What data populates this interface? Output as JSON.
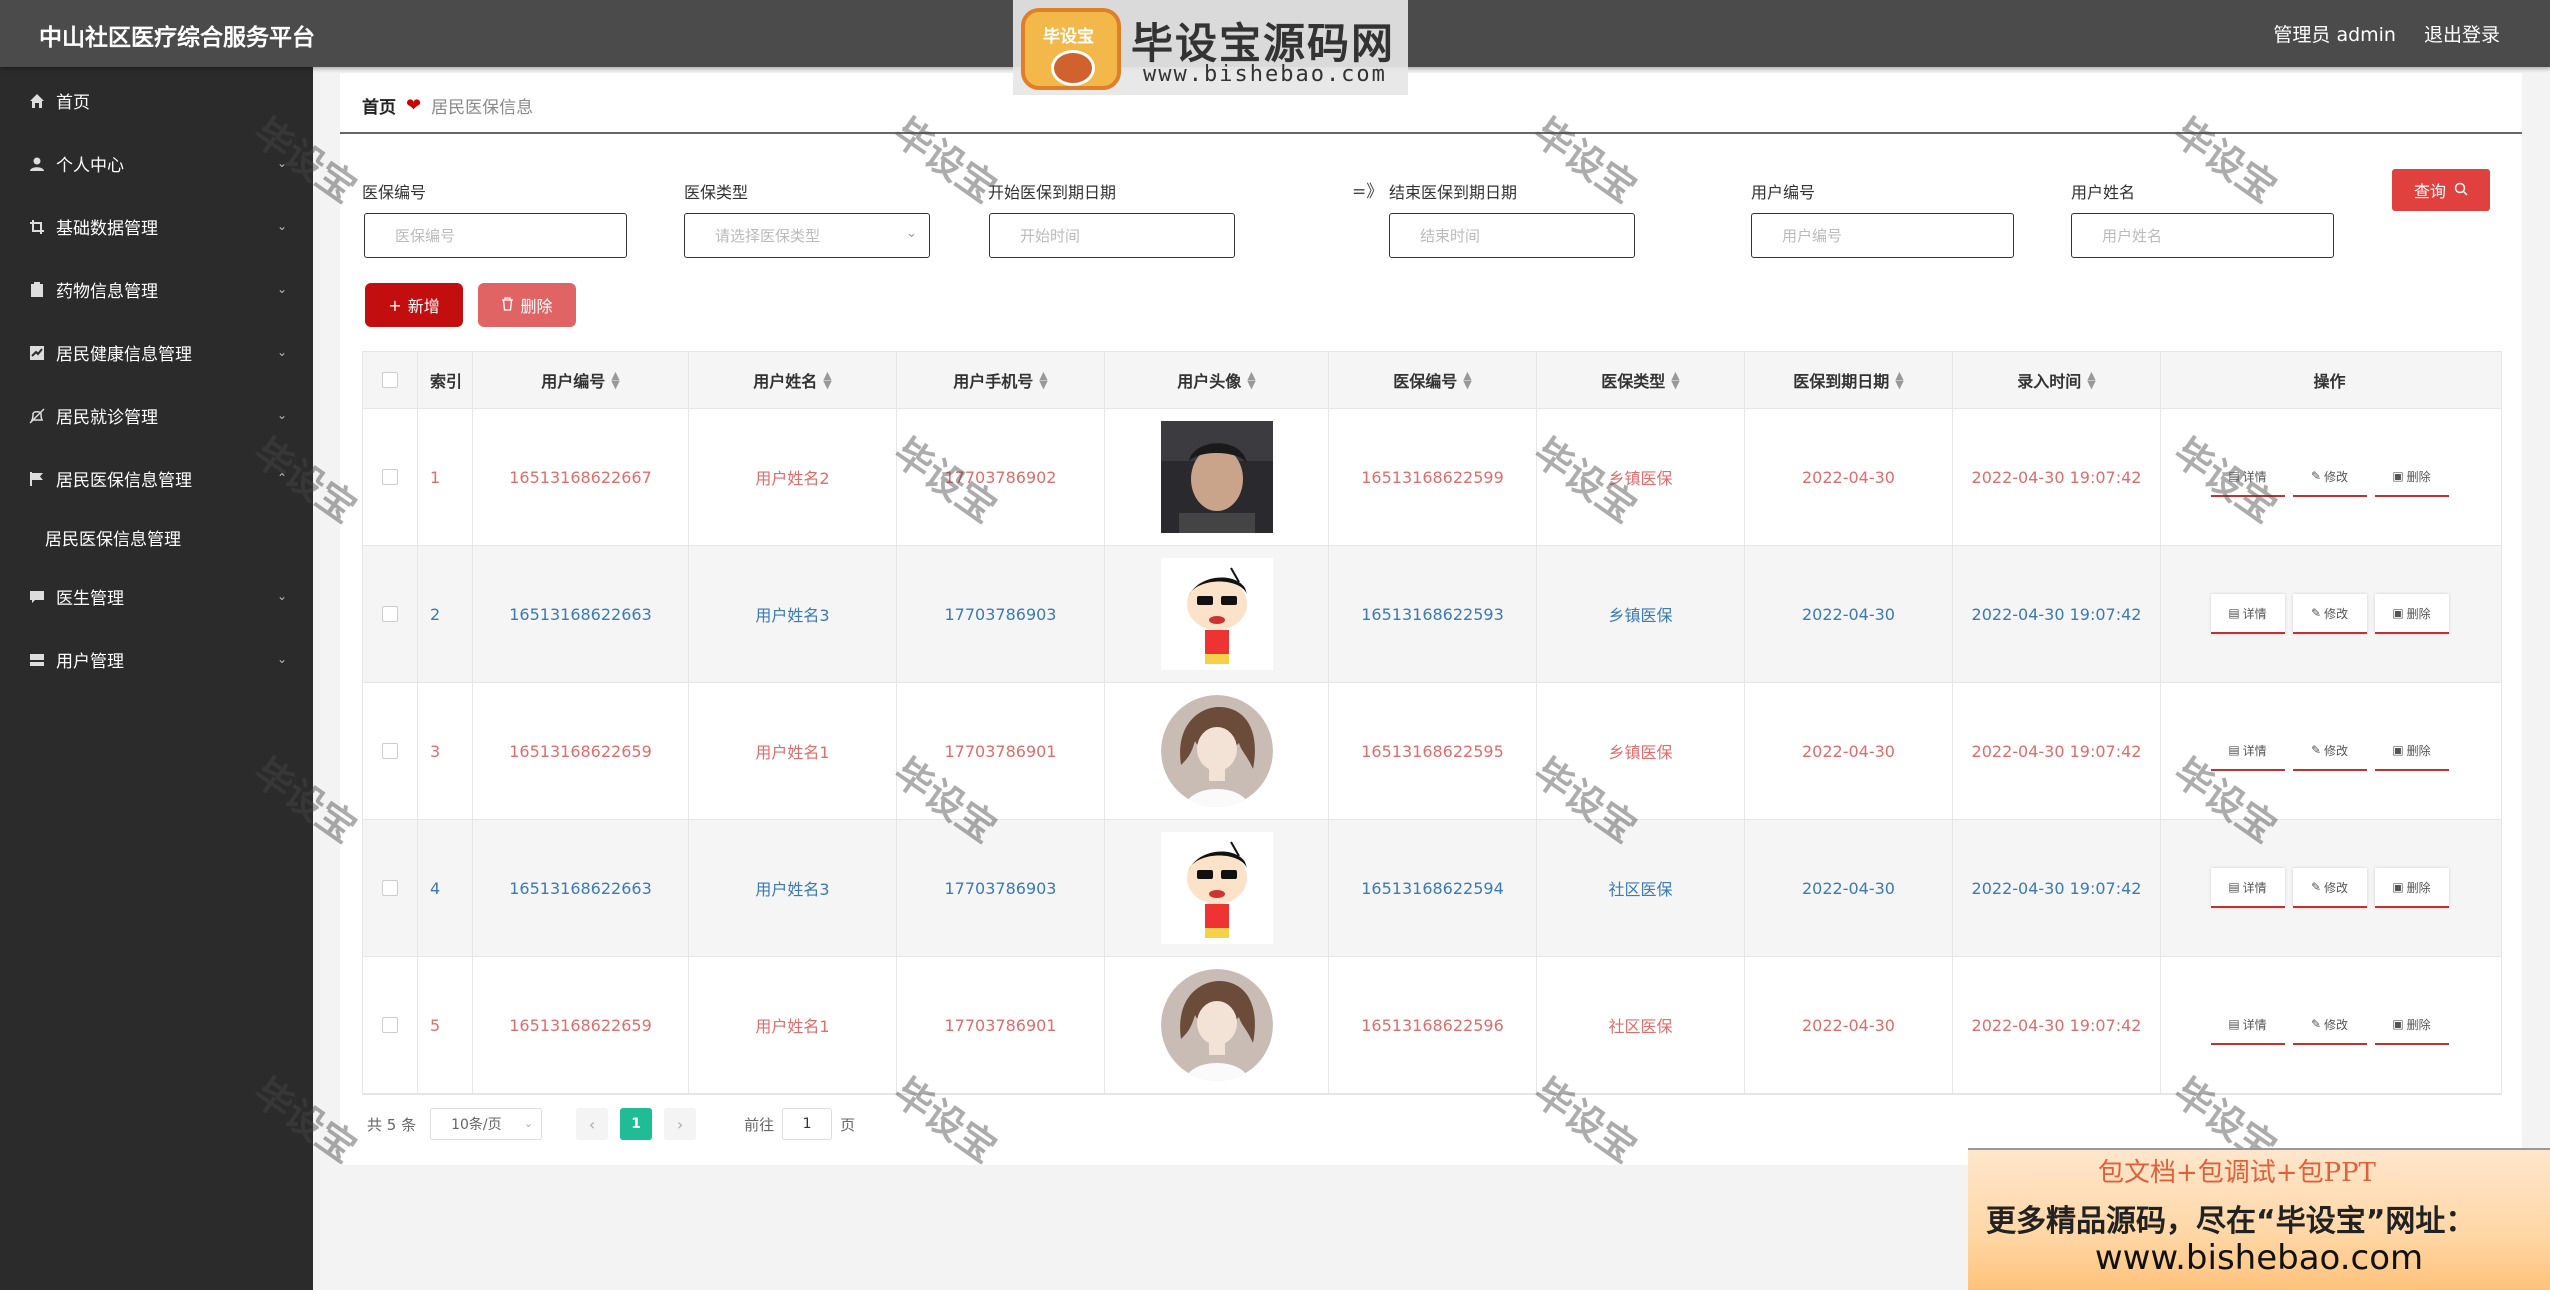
{
  "header": {
    "title": "中山社区医疗综合服务平台",
    "admin_label": "管理员 admin",
    "logout_label": "退出登录"
  },
  "watermark": {
    "badge_text": "毕设宝",
    "brand": "毕设宝源码网",
    "url": "www.bishebao.com",
    "overlay_text": "毕设宝"
  },
  "sidebar": {
    "items": [
      {
        "label": "首页",
        "icon": "home-icon"
      },
      {
        "label": "个人中心",
        "icon": "user-icon"
      },
      {
        "label": "基础数据管理",
        "icon": "crop-icon"
      },
      {
        "label": "药物信息管理",
        "icon": "clipboard-icon"
      },
      {
        "label": "居民健康信息管理",
        "icon": "chart-icon"
      },
      {
        "label": "居民就诊管理",
        "icon": "bell-icon"
      },
      {
        "label": "居民医保信息管理",
        "icon": "flag-icon"
      },
      {
        "label": "医生管理",
        "icon": "message-icon"
      },
      {
        "label": "用户管理",
        "icon": "card-icon"
      }
    ],
    "subitem": "居民医保信息管理"
  },
  "breadcrumb": {
    "home": "首页",
    "current": "居民医保信息"
  },
  "search": {
    "labels": {
      "ins_no": "医保编号",
      "ins_type": "医保类型",
      "start_date": "开始医保到期日期",
      "end_date": "结束医保到期日期",
      "user_no": "用户编号",
      "user_name": "用户姓名"
    },
    "placeholders": {
      "ins_no": "医保编号",
      "ins_type": "请选择医保类型",
      "start_date": "开始时间",
      "end_date": "结束时间",
      "user_no": "用户编号",
      "user_name": "用户姓名"
    },
    "range_sep": "=》",
    "query_button": "查询"
  },
  "actions": {
    "add": "新增",
    "delete": "删除"
  },
  "table": {
    "headers": [
      "索引",
      "用户编号",
      "用户姓名",
      "用户手机号",
      "用户头像",
      "医保编号",
      "医保类型",
      "医保到期日期",
      "录入时间",
      "操作"
    ],
    "rows": [
      {
        "index": "1",
        "user_no": "16513168622667",
        "user_name": "用户姓名2",
        "phone": "17703786902",
        "ins_no": "16513168622599",
        "ins_type": "乡镇医保",
        "expire": "2022-04-30",
        "created": "2022-04-30 19:07:42",
        "avatar": "photo"
      },
      {
        "index": "2",
        "user_no": "16513168622663",
        "user_name": "用户姓名3",
        "phone": "17703786903",
        "ins_no": "16513168622593",
        "ins_type": "乡镇医保",
        "expire": "2022-04-30",
        "created": "2022-04-30 19:07:42",
        "avatar": "cartoon"
      },
      {
        "index": "3",
        "user_no": "16513168622659",
        "user_name": "用户姓名1",
        "phone": "17703786901",
        "ins_no": "16513168622595",
        "ins_type": "乡镇医保",
        "expire": "2022-04-30",
        "created": "2022-04-30 19:07:42",
        "avatar": "girl"
      },
      {
        "index": "4",
        "user_no": "16513168622663",
        "user_name": "用户姓名3",
        "phone": "17703786903",
        "ins_no": "16513168622594",
        "ins_type": "社区医保",
        "expire": "2022-04-30",
        "created": "2022-04-30 19:07:42",
        "avatar": "cartoon"
      },
      {
        "index": "5",
        "user_no": "16513168622659",
        "user_name": "用户姓名1",
        "phone": "17703786901",
        "ins_no": "16513168622596",
        "ins_type": "社区医保",
        "expire": "2022-04-30",
        "created": "2022-04-30 19:07:42",
        "avatar": "girl"
      }
    ],
    "ops": {
      "detail": "详情",
      "edit": "修改",
      "delete": "删除"
    }
  },
  "pagination": {
    "total": "共 5 条",
    "page_size": "10条/页",
    "current_page": "1",
    "goto_label": "前往",
    "goto_value": "1",
    "page_suffix": "页"
  },
  "ad": {
    "line1": "包文档+包调试+包PPT",
    "line2": "更多精品源码，尽在“毕设宝”网址：",
    "line3": "www.bishebao.com"
  },
  "colors": {
    "topbar": "#4b4b4b",
    "sidebar": "#2b2b2b",
    "accent_red": "#c20e0e",
    "page_active": "#1fbc96",
    "row_odd_text": "#e06c6c",
    "row_even_text": "#3a7ab5"
  }
}
